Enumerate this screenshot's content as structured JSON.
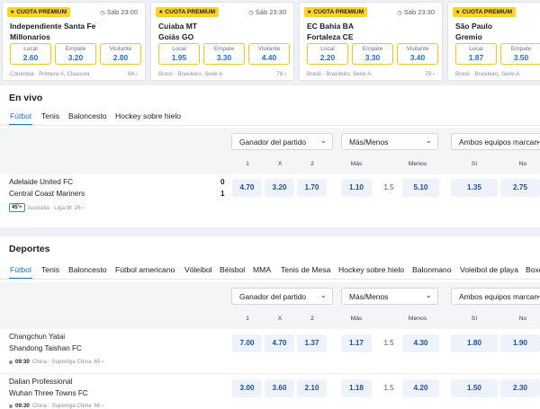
{
  "premium": {
    "badge": "CUOTA PREMIUM",
    "labels": {
      "home": "Local",
      "draw": "Empate",
      "away": "Visitante"
    },
    "cards": [
      {
        "time": "Sáb 23:00",
        "team1": "Independiente Santa Fe",
        "team2": "Millonarios",
        "odds": [
          "2.60",
          "3.20",
          "2.80"
        ],
        "league": "Colombia · Primera A, Clausura",
        "more": "64"
      },
      {
        "time": "Sáb 23:30",
        "team1": "Cuiaba MT",
        "team2": "Goiás GO",
        "odds": [
          "1.95",
          "3.30",
          "4.40"
        ],
        "league": "Brasil · Brasileiro, Serie A",
        "more": "78"
      },
      {
        "time": "Sáb 23:30",
        "team1": "EC Bahia BA",
        "team2": "Fortaleza CE",
        "odds": [
          "2.20",
          "3.30",
          "3.40"
        ],
        "league": "Brasil · Brasileiro, Serie A",
        "more": "79"
      },
      {
        "time": "",
        "team1": "São Paulo",
        "team2": "Gremio",
        "odds": [
          "1.87",
          "3.50",
          ""
        ],
        "league": "Brasil · Brasileiro, Serie A",
        "more": ""
      }
    ]
  },
  "live": {
    "title": "En vivo",
    "tabs": [
      "Fútbol",
      "Tenis",
      "Baloncesto",
      "Hockey sobre hielo"
    ],
    "selects": [
      "Ganador del partido",
      "Más/Menos",
      "Ambos equipos marcan"
    ],
    "columns": [
      "1",
      "X",
      "2",
      "Más",
      "Menos",
      "Sí",
      "No"
    ],
    "matches": [
      {
        "team1": "Adelaide United FC",
        "team2": "Central Coast Mariners",
        "score1": "0",
        "score2": "1",
        "minute": "45'+",
        "league": "Australia · Liga-W",
        "more": "26",
        "odds": [
          "4.70",
          "3.20",
          "1.70"
        ],
        "ou": [
          "1.10",
          "5.10"
        ],
        "line": "1.5",
        "btts": [
          "1.35",
          "2.75"
        ]
      }
    ]
  },
  "sports": {
    "title": "Deportes",
    "tabs": [
      "Fútbol",
      "Tenis",
      "Baloncesto",
      "Fútbol americano",
      "Vóleibol",
      "Béisbol",
      "MMA",
      "Tenis de Mesa",
      "Hockey sobre hielo",
      "Balonmano",
      "Voleibol de playa",
      "Boxeo"
    ],
    "selects": [
      "Ganador del partido",
      "Más/Menos",
      "Ambos equipos marcan"
    ],
    "columns": [
      "1",
      "X",
      "2",
      "Más",
      "Menos",
      "Sí",
      "No"
    ],
    "matches": [
      {
        "team1": "Changchun Yatai",
        "team2": "Shandong Taishan FC",
        "time": "09:30",
        "league": "China · Superliga China",
        "more": "65",
        "odds": [
          "7.00",
          "4.70",
          "1.37"
        ],
        "ou": [
          "1.17",
          "4.30"
        ],
        "line": "1.5",
        "btts": [
          "1.80",
          "1.90"
        ]
      },
      {
        "team1": "Dalian Professional",
        "team2": "Wuhan Three Towns FC",
        "time": "09:30",
        "league": "China · Superliga China",
        "more": "66",
        "odds": [
          "3.00",
          "3.60",
          "2.10"
        ],
        "ou": [
          "1.18",
          "4.20"
        ],
        "line": "1.5",
        "btts": [
          "1.50",
          "2.30"
        ]
      }
    ]
  },
  "colors": {
    "accent": "#1d6fd6",
    "premium": "#ffd426",
    "live": "#2aa86a"
  }
}
